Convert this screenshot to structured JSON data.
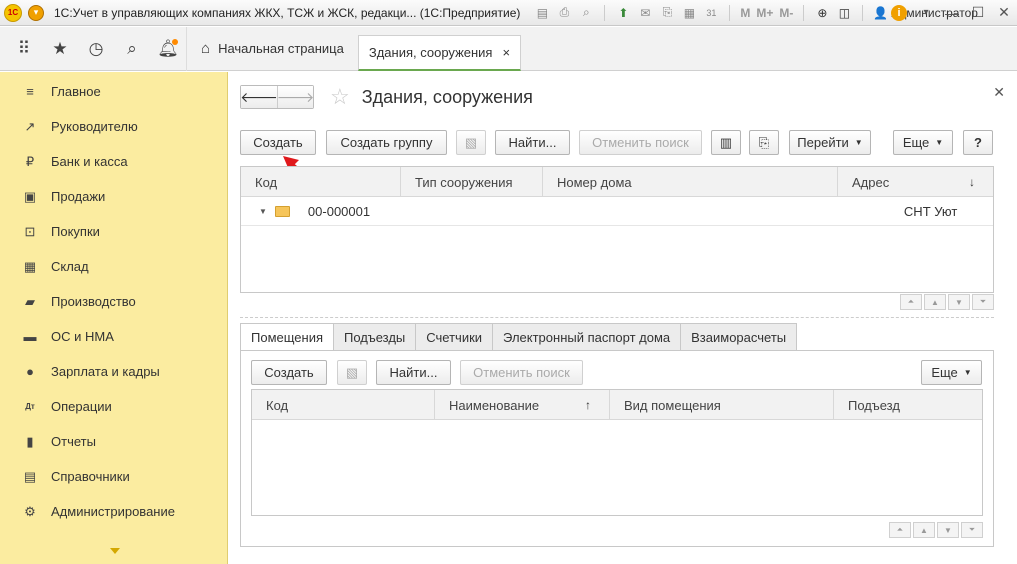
{
  "titlebar": {
    "logo": "1С",
    "title": "1С:Учет в управляющих компаниях ЖКХ, ТСЖ и ЖСК, редакци... (1С:Предприятие)",
    "memory_buttons": [
      "M",
      "M+",
      "M-"
    ],
    "calendar_day": "31",
    "user": "Администратор",
    "info": "i"
  },
  "tabbar": {
    "home_label": "Начальная страница",
    "active_tab_label": "Здания, сооружения",
    "close_glyph": "×"
  },
  "sidebar": {
    "items": [
      {
        "label": "Главное",
        "icon": "≡"
      },
      {
        "label": "Руководителю",
        "icon": "↗"
      },
      {
        "label": "Банк и касса",
        "icon": "₽"
      },
      {
        "label": "Продажи",
        "icon": "▣"
      },
      {
        "label": "Покупки",
        "icon": "⊡"
      },
      {
        "label": "Склад",
        "icon": "▦"
      },
      {
        "label": "Производство",
        "icon": "▰"
      },
      {
        "label": "ОС и НМА",
        "icon": "▬"
      },
      {
        "label": "Зарплата и кадры",
        "icon": "●"
      },
      {
        "label": "Операции",
        "icon": "Дт"
      },
      {
        "label": "Отчеты",
        "icon": "▮"
      },
      {
        "label": "Справочники",
        "icon": "▤"
      },
      {
        "label": "Администрирование",
        "icon": "⚙"
      }
    ]
  },
  "form": {
    "title": "Здания, сооружения",
    "toolbar": {
      "create": "Создать",
      "create_group": "Создать группу",
      "find": "Найти...",
      "cancel_search": "Отменить поиск",
      "goto": "Перейти",
      "more": "Еще",
      "help": "?"
    },
    "table": {
      "columns": [
        "Код",
        "Тип сооружения",
        "Номер дома",
        "Адрес"
      ],
      "rows": [
        {
          "code": "00-000001",
          "type": "",
          "house": "",
          "address": "СНТ Уют"
        }
      ]
    },
    "subtabs": [
      "Помещения",
      "Подъезды",
      "Счетчики",
      "Электронный паспорт дома",
      "Взаиморасчеты"
    ],
    "subtoolbar": {
      "create": "Создать",
      "find": "Найти...",
      "cancel_search": "Отменить поиск",
      "more": "Еще"
    },
    "subtable": {
      "columns": [
        "Код",
        "Наименование",
        "Вид помещения",
        "Подъезд"
      ]
    }
  },
  "colors": {
    "sidebar_bg": "#fbeca0",
    "accent_tab": "#6aa84f",
    "annotation_arrow": "#e0191c"
  }
}
